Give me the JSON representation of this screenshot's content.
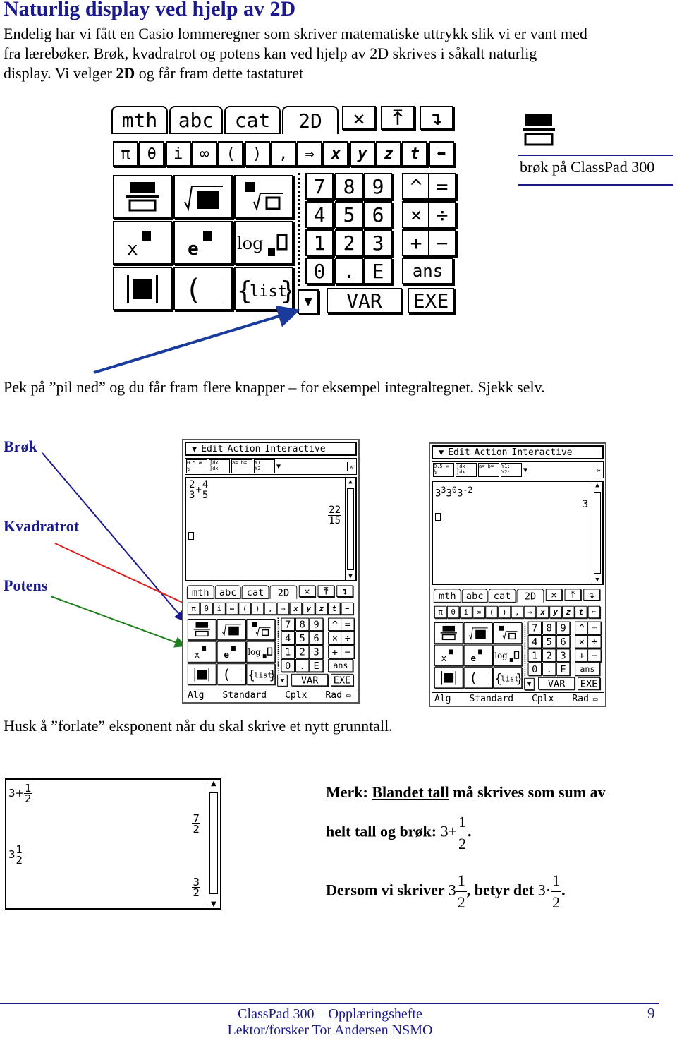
{
  "title": "Naturlig display ved hjelp av 2D",
  "intro": {
    "line1": "Endelig har vi fått en Casio lommeregner som skriver matematiske uttrykk slik vi er vant med",
    "line2": "fra lærebøker. Brøk, kvadratrot og potens kan ved hjelp av 2D skrives i såkalt naturlig",
    "line3_a": "display. Vi velger ",
    "line3_b": "2D",
    "line3_c": " og får fram dette tastaturet"
  },
  "keyboard": {
    "tabs": [
      "mth",
      "abc",
      "cat",
      "2D"
    ],
    "row2": [
      "π",
      "θ",
      "i",
      "∞",
      "(",
      ")",
      ",",
      "⇒",
      "x",
      "y",
      "z",
      "t",
      "⬅"
    ],
    "numpad": [
      [
        "7",
        "8",
        "9",
        "^",
        "="
      ],
      [
        "4",
        "5",
        "6",
        "×",
        "÷"
      ],
      [
        "1",
        "2",
        "3",
        "+",
        "−"
      ],
      [
        "0",
        ".",
        "E",
        "ans"
      ]
    ],
    "var": "VAR",
    "exe": "EXE",
    "more": "▼"
  },
  "side_note": {
    "caption": "brøk på ClassPad 300",
    "accent": "#1a1a8c"
  },
  "pointer_text": "Pek på ”pil ned” og du får fram flere knapper – for eksempel integraltegnet. Sjekk selv.",
  "labels": {
    "brok": "Brøk",
    "kvadratrot": "Kvadratrot",
    "potens": "Potens"
  },
  "arrow_colors": {
    "brok": "#1a1a8c",
    "kvadratrot": "#e02020",
    "potens": "#208020",
    "pointer": "#1a3a9c"
  },
  "screen": {
    "menu": [
      "Edit",
      "Action",
      "Interactive"
    ],
    "status": [
      "Alg",
      "Standard",
      "Cplx",
      "Rad"
    ],
    "toolbar": [
      "0.5 ⇄ ½",
      "∫dx ∫dx",
      "a= b=",
      "Y1: Y2:"
    ]
  },
  "screen1": {
    "expr": {
      "a_n": "2",
      "a_d": "3",
      "op": "+",
      "b_n": "4",
      "b_d": "5"
    },
    "result": {
      "n": "22",
      "d": "15"
    }
  },
  "screen2": {
    "expr": [
      "3",
      "3",
      "3",
      "0",
      "3",
      "-2"
    ],
    "result": "3"
  },
  "reminder": "Husk å ”forlate” eksponent når du skal skrive et nytt grunntall.",
  "mini_screen": {
    "expr1": {
      "whole": "3+",
      "n": "1",
      "d": "2"
    },
    "res1": {
      "n": "7",
      "d": "2"
    },
    "expr2": {
      "whole": "3",
      "n": "1",
      "d": "2"
    },
    "res2": {
      "n": "3",
      "d": "2"
    }
  },
  "note": {
    "merk": "Merk: ",
    "underlined": "Blandet tall",
    "rest1": " må skrives som sum av",
    "line2": "helt tall og brøk:",
    "l2_math": "3+",
    "frac": {
      "n": "1",
      "d": "2"
    },
    "line3_a": "Dersom vi skriver",
    "l3_whole": "3",
    "line3_b": ", betyr det",
    "l3_prod": "3·",
    "dot": "."
  },
  "footer": {
    "line1": "ClassPad 300 – Opplæringshefte",
    "line2": "Lektor/forsker Tor Andersen NSMO",
    "page": "9"
  }
}
